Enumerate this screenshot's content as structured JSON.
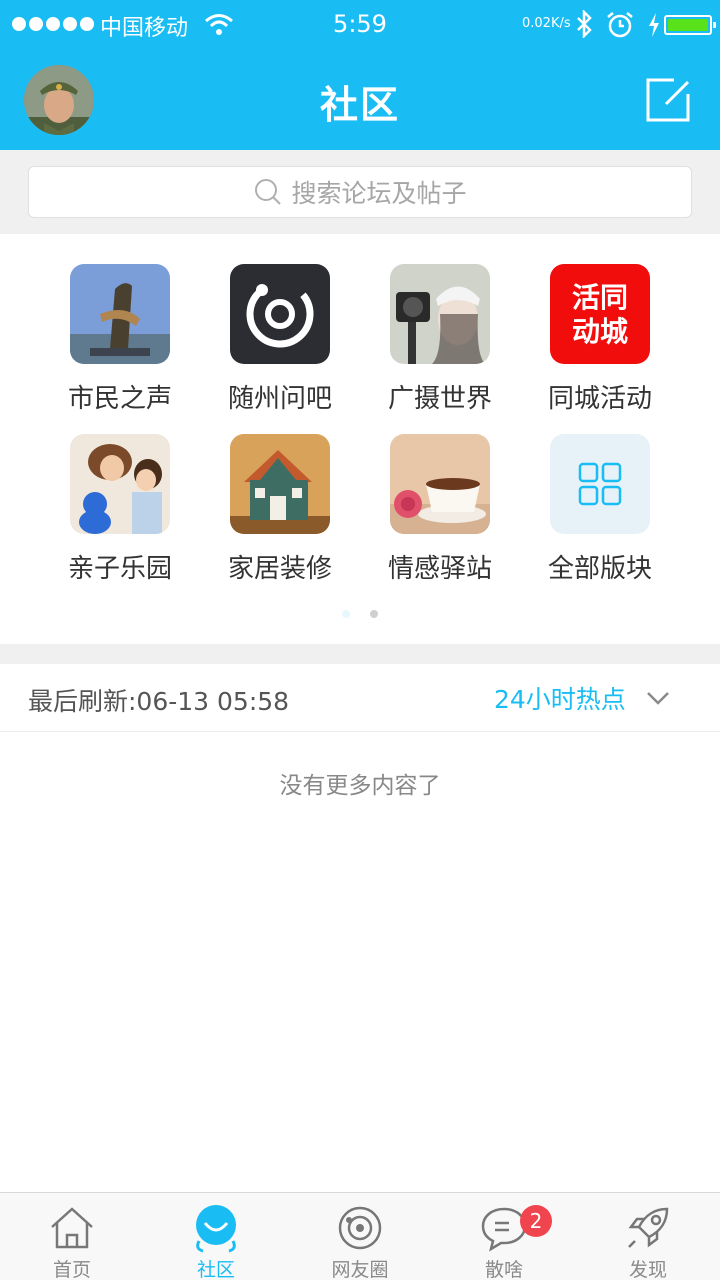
{
  "status_bar": {
    "carrier": "中国移动",
    "time": "5:59",
    "net_speed": "0.02K/s"
  },
  "header": {
    "title": "社区"
  },
  "search": {
    "placeholder": "搜索论坛及帖子"
  },
  "boards": [
    {
      "label": "市民之声",
      "icon": "monument-photo"
    },
    {
      "label": "随州问吧",
      "icon": "ring-logo"
    },
    {
      "label": "广摄世界",
      "icon": "camera-girl-photo"
    },
    {
      "label": "同城活动",
      "icon": "event-logo",
      "icon_text_1": "活同",
      "icon_text_2": "动城"
    },
    {
      "label": "亲子乐园",
      "icon": "family-photo"
    },
    {
      "label": "家居装修",
      "icon": "house-photo"
    },
    {
      "label": "情感驿站",
      "icon": "coffee-rose-photo"
    },
    {
      "label": "全部版块",
      "icon": "grid-icon"
    }
  ],
  "pager": {
    "pages": 2,
    "current": 1
  },
  "feed": {
    "refresh_text": "最后刷新:06-13 05:58",
    "filter_label": "24小时热点",
    "empty_text": "没有更多内容了"
  },
  "tabs": [
    {
      "label": "首页",
      "icon": "home-icon"
    },
    {
      "label": "社区",
      "icon": "community-icon",
      "active": true
    },
    {
      "label": "网友圈",
      "icon": "circle-icon"
    },
    {
      "label": "散啥",
      "icon": "chat-icon",
      "badge": "2"
    },
    {
      "label": "发现",
      "icon": "rocket-icon"
    }
  ],
  "colors": {
    "brand": "#19bdf4",
    "badge": "#f0454e",
    "battery": "#59e21a"
  }
}
